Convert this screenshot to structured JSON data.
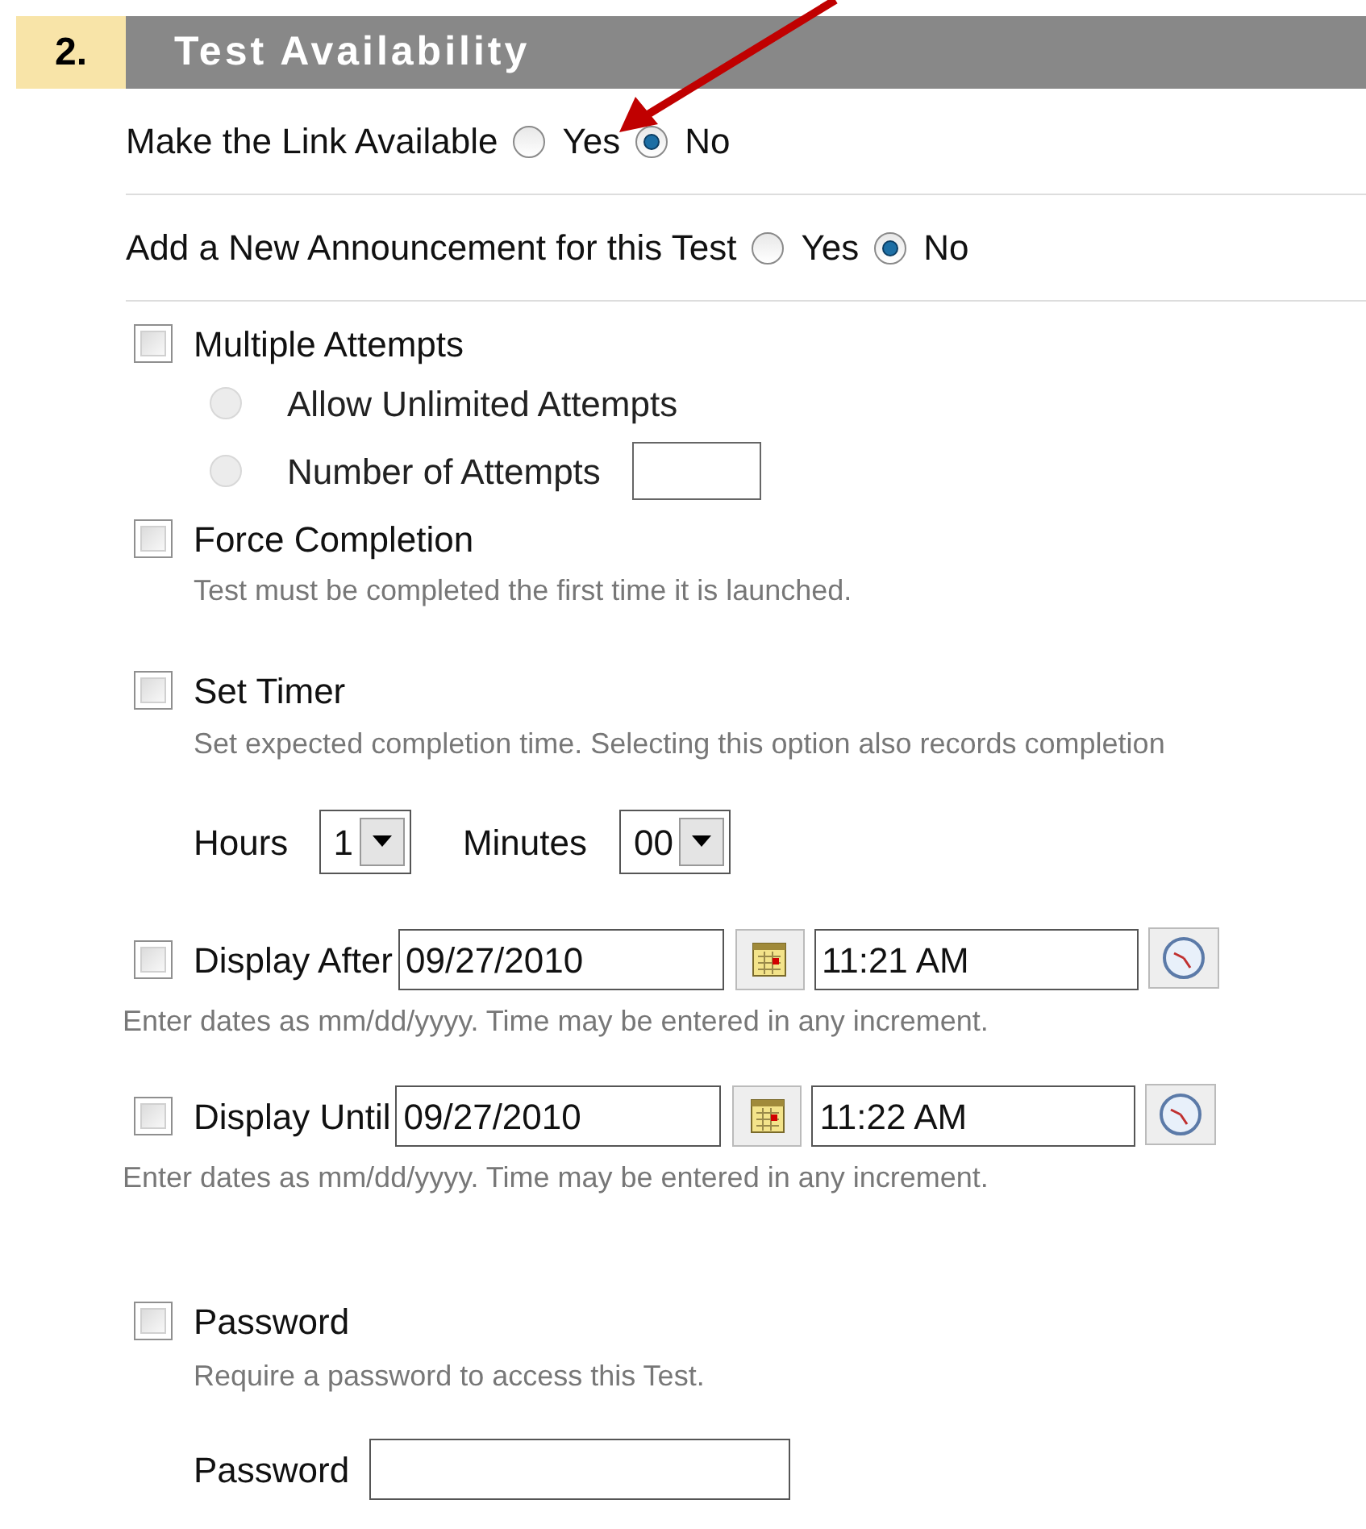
{
  "section": {
    "number": "2.",
    "title": "Test Availability"
  },
  "radio_groups": [
    {
      "label": "Make the Link Available",
      "options": [
        {
          "label": "Yes",
          "selected": false
        },
        {
          "label": "No",
          "selected": true
        }
      ]
    },
    {
      "label": "Add a New Announcement for this Test",
      "options": [
        {
          "label": "Yes",
          "selected": false
        },
        {
          "label": "No",
          "selected": true
        }
      ]
    }
  ],
  "options": [
    {
      "kind": "attempts",
      "label": "Multiple Attempts",
      "checked": false,
      "choices": [
        {
          "kind": "plain",
          "label": "Allow Unlimited Attempts",
          "selected": false,
          "disabled": true
        },
        {
          "kind": "number",
          "label": "Number of Attempts",
          "selected": false,
          "disabled": true
        }
      ]
    },
    {
      "kind": "note",
      "label": "Force Completion",
      "checked": false,
      "description": "Test must be completed the first time it is launched."
    },
    {
      "kind": "timer",
      "label": "Set Timer",
      "checked": false,
      "description": "Set expected completion time. Selecting this option also records completion",
      "hours_label": "Hours",
      "hours": "1",
      "minutes_label": "Minutes",
      "minutes": "00"
    },
    {
      "kind": "date",
      "label": "Display After",
      "checked": false,
      "date": "09/27/2010",
      "time": "11:21 AM",
      "hint": "Enter dates as mm/dd/yyyy. Time may be entered in any increment."
    },
    {
      "kind": "date",
      "label": "Display Until",
      "checked": false,
      "date": "09/27/2010",
      "time": "11:22 AM",
      "hint": "Enter dates as mm/dd/yyyy. Time may be entered in any increment."
    },
    {
      "kind": "password",
      "label": "Password",
      "checked": false,
      "description": "Require a password to access this Test.",
      "field_label": "Password"
    }
  ]
}
